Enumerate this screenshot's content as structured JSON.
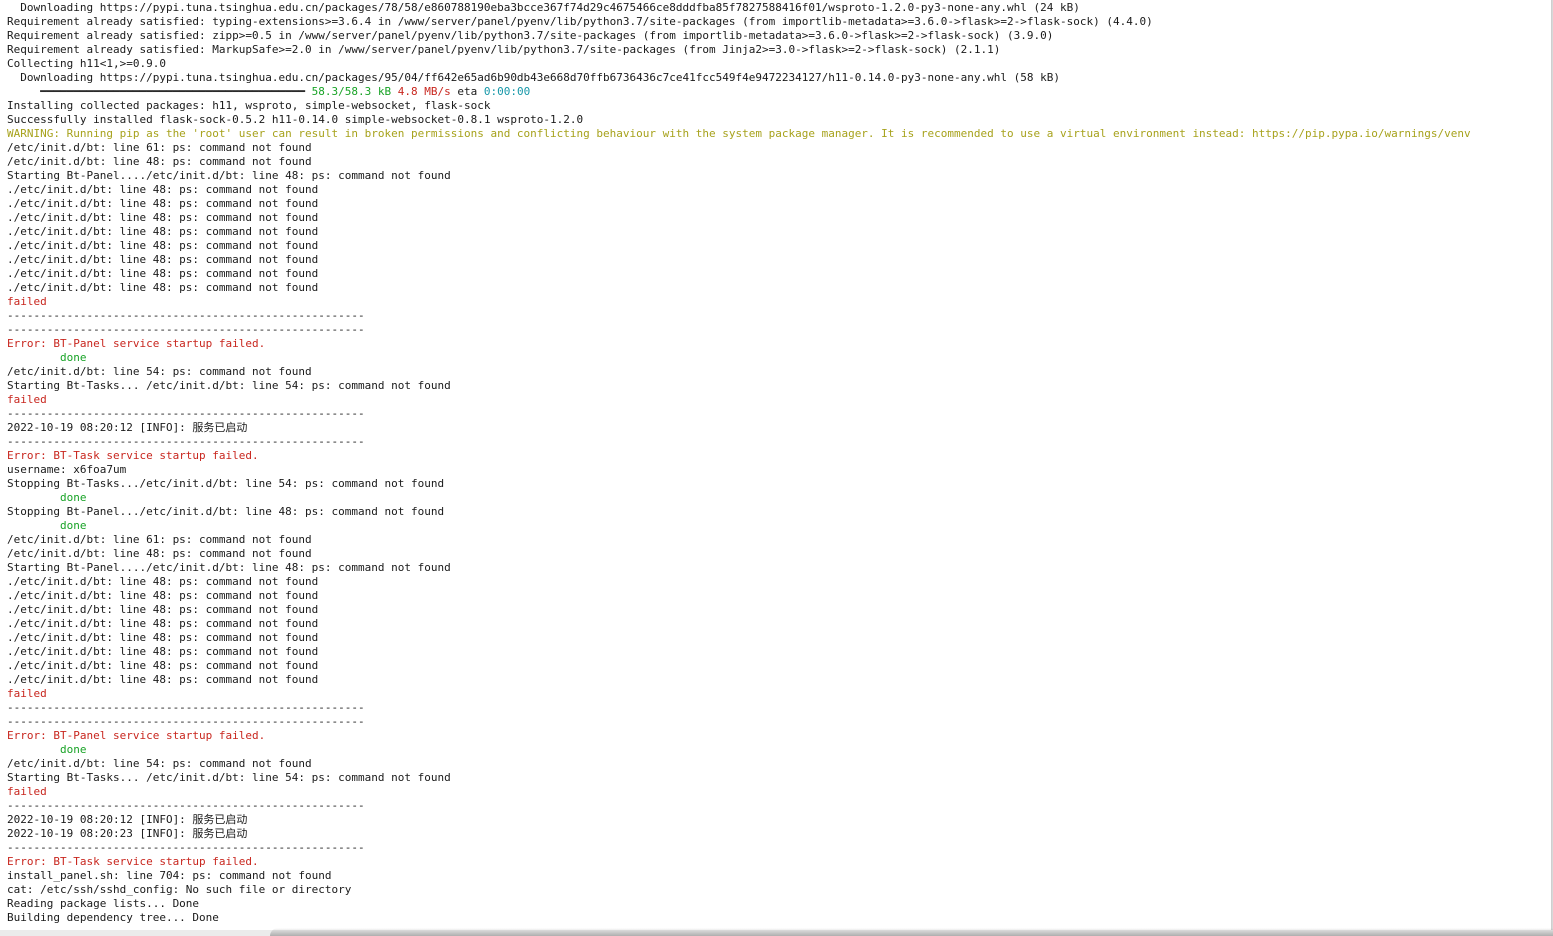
{
  "terminal": {
    "lines": [
      [
        {
          "t": "  Downloading https://pypi.tuna.tsinghua.edu.cn/packages/78/58/e860788190eba3bcce367f74d29c4675466ce8dddfba85f7827588416f01/wsproto-1.2.0-py3-none-any.whl (24 kB)",
          "c": "default"
        }
      ],
      [
        {
          "t": "Requirement already satisfied: typing-extensions>=3.6.4 in /www/server/panel/pyenv/lib/python3.7/site-packages (from importlib-metadata>=3.6.0->flask>=2->flask-sock) (4.4.0)",
          "c": "default"
        }
      ],
      [
        {
          "t": "Requirement already satisfied: zipp>=0.5 in /www/server/panel/pyenv/lib/python3.7/site-packages (from importlib-metadata>=3.6.0->flask>=2->flask-sock) (3.9.0)",
          "c": "default"
        }
      ],
      [
        {
          "t": "Requirement already satisfied: MarkupSafe>=2.0 in /www/server/panel/pyenv/lib/python3.7/site-packages (from Jinja2>=3.0->flask>=2->flask-sock) (2.1.1)",
          "c": "default"
        }
      ],
      [
        {
          "t": "Collecting h11<1,>=0.9.0",
          "c": "default"
        }
      ],
      [
        {
          "t": "  Downloading https://pypi.tuna.tsinghua.edu.cn/packages/95/04/ff642e65ad6b90db43e668d70ffb6736436c7ce41fcc549f4e9472234127/h11-0.14.0-py3-none-any.whl (58 kB)",
          "c": "default"
        }
      ],
      [
        {
          "t": "     ━━━━━━━━━━━━━━━━━━━━━━━━━━━━━━━━━━━━━━━━ ",
          "c": "bar"
        },
        {
          "t": "58.3/58.3 kB",
          "c": "green"
        },
        {
          "t": " ",
          "c": "default"
        },
        {
          "t": "4.8 MB/s",
          "c": "red"
        },
        {
          "t": " eta ",
          "c": "default"
        },
        {
          "t": "0:00:00",
          "c": "cyan"
        }
      ],
      [
        {
          "t": "Installing collected packages: h11, wsproto, simple-websocket, flask-sock",
          "c": "default"
        }
      ],
      [
        {
          "t": "Successfully installed flask-sock-0.5.2 h11-0.14.0 simple-websocket-0.8.1 wsproto-1.2.0",
          "c": "default"
        }
      ],
      [
        {
          "t": "WARNING: Running pip as the 'root' user can result in broken permissions and conflicting behaviour with the system package manager. It is recommended to use a virtual environment instead: https://pip.pypa.io/warnings/venv",
          "c": "yellow"
        }
      ],
      [
        {
          "t": "/etc/init.d/bt: line 61: ps: command not found",
          "c": "default"
        }
      ],
      [
        {
          "t": "/etc/init.d/bt: line 48: ps: command not found",
          "c": "default"
        }
      ],
      [
        {
          "t": "Starting Bt-Panel..../etc/init.d/bt: line 48: ps: command not found",
          "c": "default"
        }
      ],
      [
        {
          "t": "./etc/init.d/bt: line 48: ps: command not found",
          "c": "default"
        }
      ],
      [
        {
          "t": "./etc/init.d/bt: line 48: ps: command not found",
          "c": "default"
        }
      ],
      [
        {
          "t": "./etc/init.d/bt: line 48: ps: command not found",
          "c": "default"
        }
      ],
      [
        {
          "t": "./etc/init.d/bt: line 48: ps: command not found",
          "c": "default"
        }
      ],
      [
        {
          "t": "./etc/init.d/bt: line 48: ps: command not found",
          "c": "default"
        }
      ],
      [
        {
          "t": "./etc/init.d/bt: line 48: ps: command not found",
          "c": "default"
        }
      ],
      [
        {
          "t": "./etc/init.d/bt: line 48: ps: command not found",
          "c": "default"
        }
      ],
      [
        {
          "t": "./etc/init.d/bt: line 48: ps: command not found",
          "c": "default"
        }
      ],
      [
        {
          "t": "failed",
          "c": "red"
        }
      ],
      [
        {
          "t": "------------------------------------------------------",
          "c": "default"
        }
      ],
      [
        {
          "t": "------------------------------------------------------",
          "c": "default"
        }
      ],
      [
        {
          "t": "Error: BT-Panel service startup failed.",
          "c": "red"
        }
      ],
      [
        {
          "t": "        done",
          "c": "green"
        }
      ],
      [
        {
          "t": "/etc/init.d/bt: line 54: ps: command not found",
          "c": "default"
        }
      ],
      [
        {
          "t": "Starting Bt-Tasks... /etc/init.d/bt: line 54: ps: command not found",
          "c": "default"
        }
      ],
      [
        {
          "t": "failed",
          "c": "red"
        }
      ],
      [
        {
          "t": "------------------------------------------------------",
          "c": "default"
        }
      ],
      [
        {
          "t": "2022-10-19 08:20:12 [INFO]: 服务已启动",
          "c": "default"
        }
      ],
      [
        {
          "t": "------------------------------------------------------",
          "c": "default"
        }
      ],
      [
        {
          "t": "Error: BT-Task service startup failed.",
          "c": "red"
        }
      ],
      [
        {
          "t": "username: x6foa7um",
          "c": "default"
        }
      ],
      [
        {
          "t": "Stopping Bt-Tasks.../etc/init.d/bt: line 54: ps: command not found",
          "c": "default"
        }
      ],
      [
        {
          "t": "        done",
          "c": "green"
        }
      ],
      [
        {
          "t": "Stopping Bt-Panel.../etc/init.d/bt: line 48: ps: command not found",
          "c": "default"
        }
      ],
      [
        {
          "t": "        done",
          "c": "green"
        }
      ],
      [
        {
          "t": "/etc/init.d/bt: line 61: ps: command not found",
          "c": "default"
        }
      ],
      [
        {
          "t": "/etc/init.d/bt: line 48: ps: command not found",
          "c": "default"
        }
      ],
      [
        {
          "t": "Starting Bt-Panel..../etc/init.d/bt: line 48: ps: command not found",
          "c": "default"
        }
      ],
      [
        {
          "t": "./etc/init.d/bt: line 48: ps: command not found",
          "c": "default"
        }
      ],
      [
        {
          "t": "./etc/init.d/bt: line 48: ps: command not found",
          "c": "default"
        }
      ],
      [
        {
          "t": "./etc/init.d/bt: line 48: ps: command not found",
          "c": "default"
        }
      ],
      [
        {
          "t": "./etc/init.d/bt: line 48: ps: command not found",
          "c": "default"
        }
      ],
      [
        {
          "t": "./etc/init.d/bt: line 48: ps: command not found",
          "c": "default"
        }
      ],
      [
        {
          "t": "./etc/init.d/bt: line 48: ps: command not found",
          "c": "default"
        }
      ],
      [
        {
          "t": "./etc/init.d/bt: line 48: ps: command not found",
          "c": "default"
        }
      ],
      [
        {
          "t": "./etc/init.d/bt: line 48: ps: command not found",
          "c": "default"
        }
      ],
      [
        {
          "t": "failed",
          "c": "red"
        }
      ],
      [
        {
          "t": "------------------------------------------------------",
          "c": "default"
        }
      ],
      [
        {
          "t": "------------------------------------------------------",
          "c": "default"
        }
      ],
      [
        {
          "t": "Error: BT-Panel service startup failed.",
          "c": "red"
        }
      ],
      [
        {
          "t": "        done",
          "c": "green"
        }
      ],
      [
        {
          "t": "/etc/init.d/bt: line 54: ps: command not found",
          "c": "default"
        }
      ],
      [
        {
          "t": "Starting Bt-Tasks... /etc/init.d/bt: line 54: ps: command not found",
          "c": "default"
        }
      ],
      [
        {
          "t": "failed",
          "c": "red"
        }
      ],
      [
        {
          "t": "------------------------------------------------------",
          "c": "default"
        }
      ],
      [
        {
          "t": "2022-10-19 08:20:12 [INFO]: 服务已启动",
          "c": "default"
        }
      ],
      [
        {
          "t": "2022-10-19 08:20:23 [INFO]: 服务已启动",
          "c": "default"
        }
      ],
      [
        {
          "t": "------------------------------------------------------",
          "c": "default"
        }
      ],
      [
        {
          "t": "Error: BT-Task service startup failed.",
          "c": "red"
        }
      ],
      [
        {
          "t": "install_panel.sh: line 704: ps: command not found",
          "c": "default"
        }
      ],
      [
        {
          "t": "cat: /etc/ssh/sshd_config: No such file or directory",
          "c": "default"
        }
      ],
      [
        {
          "t": "Reading package lists... Done",
          "c": "default"
        }
      ],
      [
        {
          "t": "Building dependency tree... Done",
          "c": "default"
        }
      ]
    ]
  },
  "colors": {
    "background": "#ffffff",
    "text": "#1a1a1a",
    "red": "#c8261e",
    "green": "#18a326",
    "yellow": "#a7a21c",
    "cyan": "#1597a8"
  }
}
